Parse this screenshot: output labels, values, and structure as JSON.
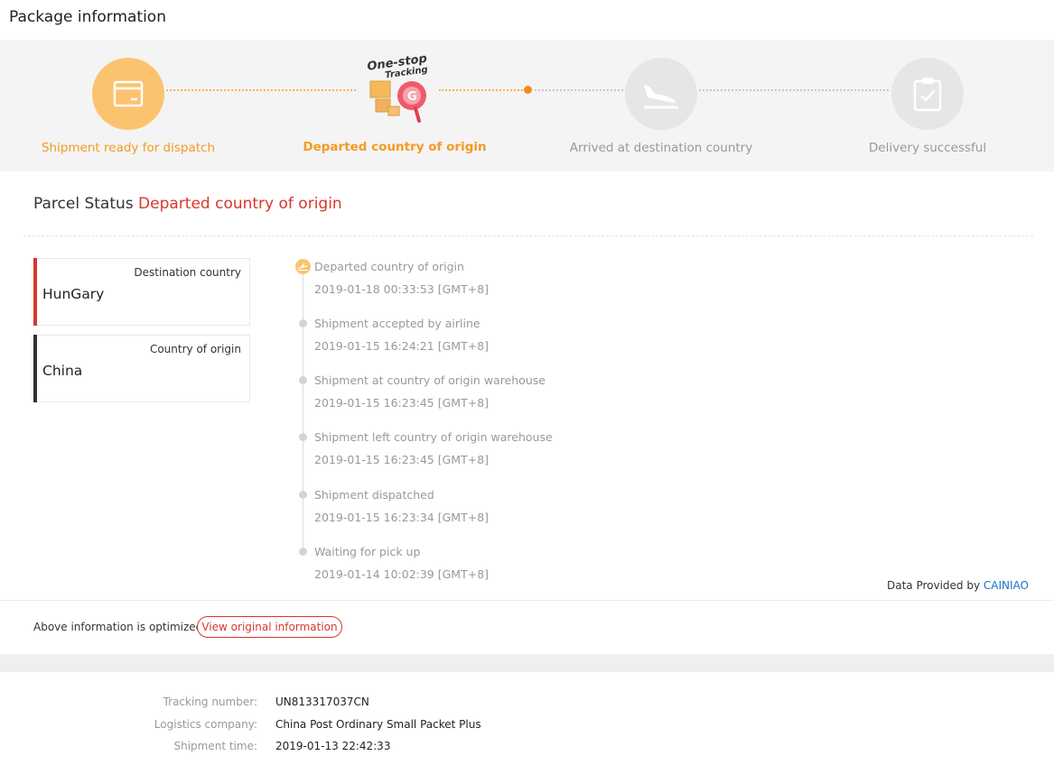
{
  "header": {
    "title": "Package information"
  },
  "progress": {
    "steps": [
      {
        "label": "Shipment ready for dispatch",
        "state": "done",
        "icon": "package-icon"
      },
      {
        "label": "Departed country of origin",
        "state": "active",
        "icon": "one-stop-tracking-icon"
      },
      {
        "label": "Arrived at destination country",
        "state": "todo",
        "icon": "airplane-landing-icon"
      },
      {
        "label": "Delivery successful",
        "state": "todo",
        "icon": "clipboard-check-icon"
      }
    ],
    "logo": {
      "line1": "One-stop",
      "line2": "Tracking"
    }
  },
  "status": {
    "label": "Parcel Status",
    "value": "Departed country of origin"
  },
  "destination": {
    "label": "Destination country",
    "name": "HunGary"
  },
  "origin": {
    "label": "Country of origin",
    "name": "China"
  },
  "timeline": [
    {
      "title": "Departed country of origin",
      "time": "2019-01-18 00:33:53 [GMT+8]"
    },
    {
      "title": "Shipment accepted by airline",
      "time": "2019-01-15 16:24:21 [GMT+8]"
    },
    {
      "title": "Shipment at country of origin warehouse",
      "time": "2019-01-15 16:23:45 [GMT+8]"
    },
    {
      "title": "Shipment left country of origin warehouse",
      "time": "2019-01-15 16:23:45 [GMT+8]"
    },
    {
      "title": "Shipment dispatched",
      "time": "2019-01-15 16:23:34 [GMT+8]"
    },
    {
      "title": "Waiting for pick up",
      "time": "2019-01-14 10:02:39 [GMT+8]"
    }
  ],
  "provider": {
    "prefix": "Data Provided by",
    "name": "CAINIAO"
  },
  "optimized": {
    "text": "Above information is optimized",
    "button": "View original information"
  },
  "details": [
    {
      "key": "Tracking number:",
      "value": "UN813317037CN"
    },
    {
      "key": "Logistics company:",
      "value": "China Post Ordinary Small Packet Plus"
    },
    {
      "key": "Shipment time:",
      "value": "2019-01-13 22:42:33"
    }
  ],
  "colors": {
    "accent": "#f59a23",
    "status_red": "#d9362b",
    "link_blue": "#1a73c5"
  }
}
